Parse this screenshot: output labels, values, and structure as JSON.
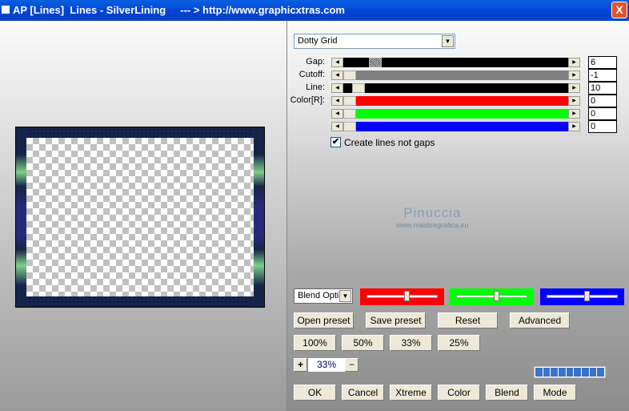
{
  "window": {
    "title": "AP [Lines]  Lines - SilverLining     --- > http://www.graphicxtras.com",
    "close_label": "X"
  },
  "preset_dropdown": {
    "value": "Dotty Grid"
  },
  "sliders": [
    {
      "label": "Gap:",
      "value": "6",
      "color": "#000000",
      "position": 0.12
    },
    {
      "label": "Cutoff:",
      "value": "-1",
      "color": "#808080",
      "position": 0.0
    },
    {
      "label": "Line:",
      "value": "10",
      "color": "#000000",
      "position": 0.04
    },
    {
      "label": "Color[R]:",
      "value": "0",
      "color": "#ff0000",
      "position": 0.0
    },
    {
      "label": "",
      "value": "0",
      "color": "#00ff00",
      "position": 0.0
    },
    {
      "label": "",
      "value": "0",
      "color": "#0000ff",
      "position": 0.0
    }
  ],
  "checkbox": {
    "label": "Create lines not gaps",
    "checked": true
  },
  "watermark": {
    "name": "Pinuccia",
    "url": "www.maidiregrafica.eu"
  },
  "blend_dropdown": {
    "value": "Blend Opti"
  },
  "color_panels": [
    {
      "color": "#ff0000",
      "position": 0.55
    },
    {
      "color": "#00ff00",
      "position": 0.55
    },
    {
      "color": "#0000ff",
      "position": 0.55
    }
  ],
  "preset_buttons": [
    "Open preset",
    "Save preset",
    "Reset",
    "Advanced"
  ],
  "zoom_buttons": [
    "100%",
    "50%",
    "33%",
    "25%"
  ],
  "zoom": {
    "plus": "+",
    "value": "33%",
    "minus": "−"
  },
  "progress": {
    "segments": 9
  },
  "bottom_buttons": [
    "OK",
    "Cancel",
    "Xtreme",
    "Color",
    "Blend",
    "Mode"
  ]
}
